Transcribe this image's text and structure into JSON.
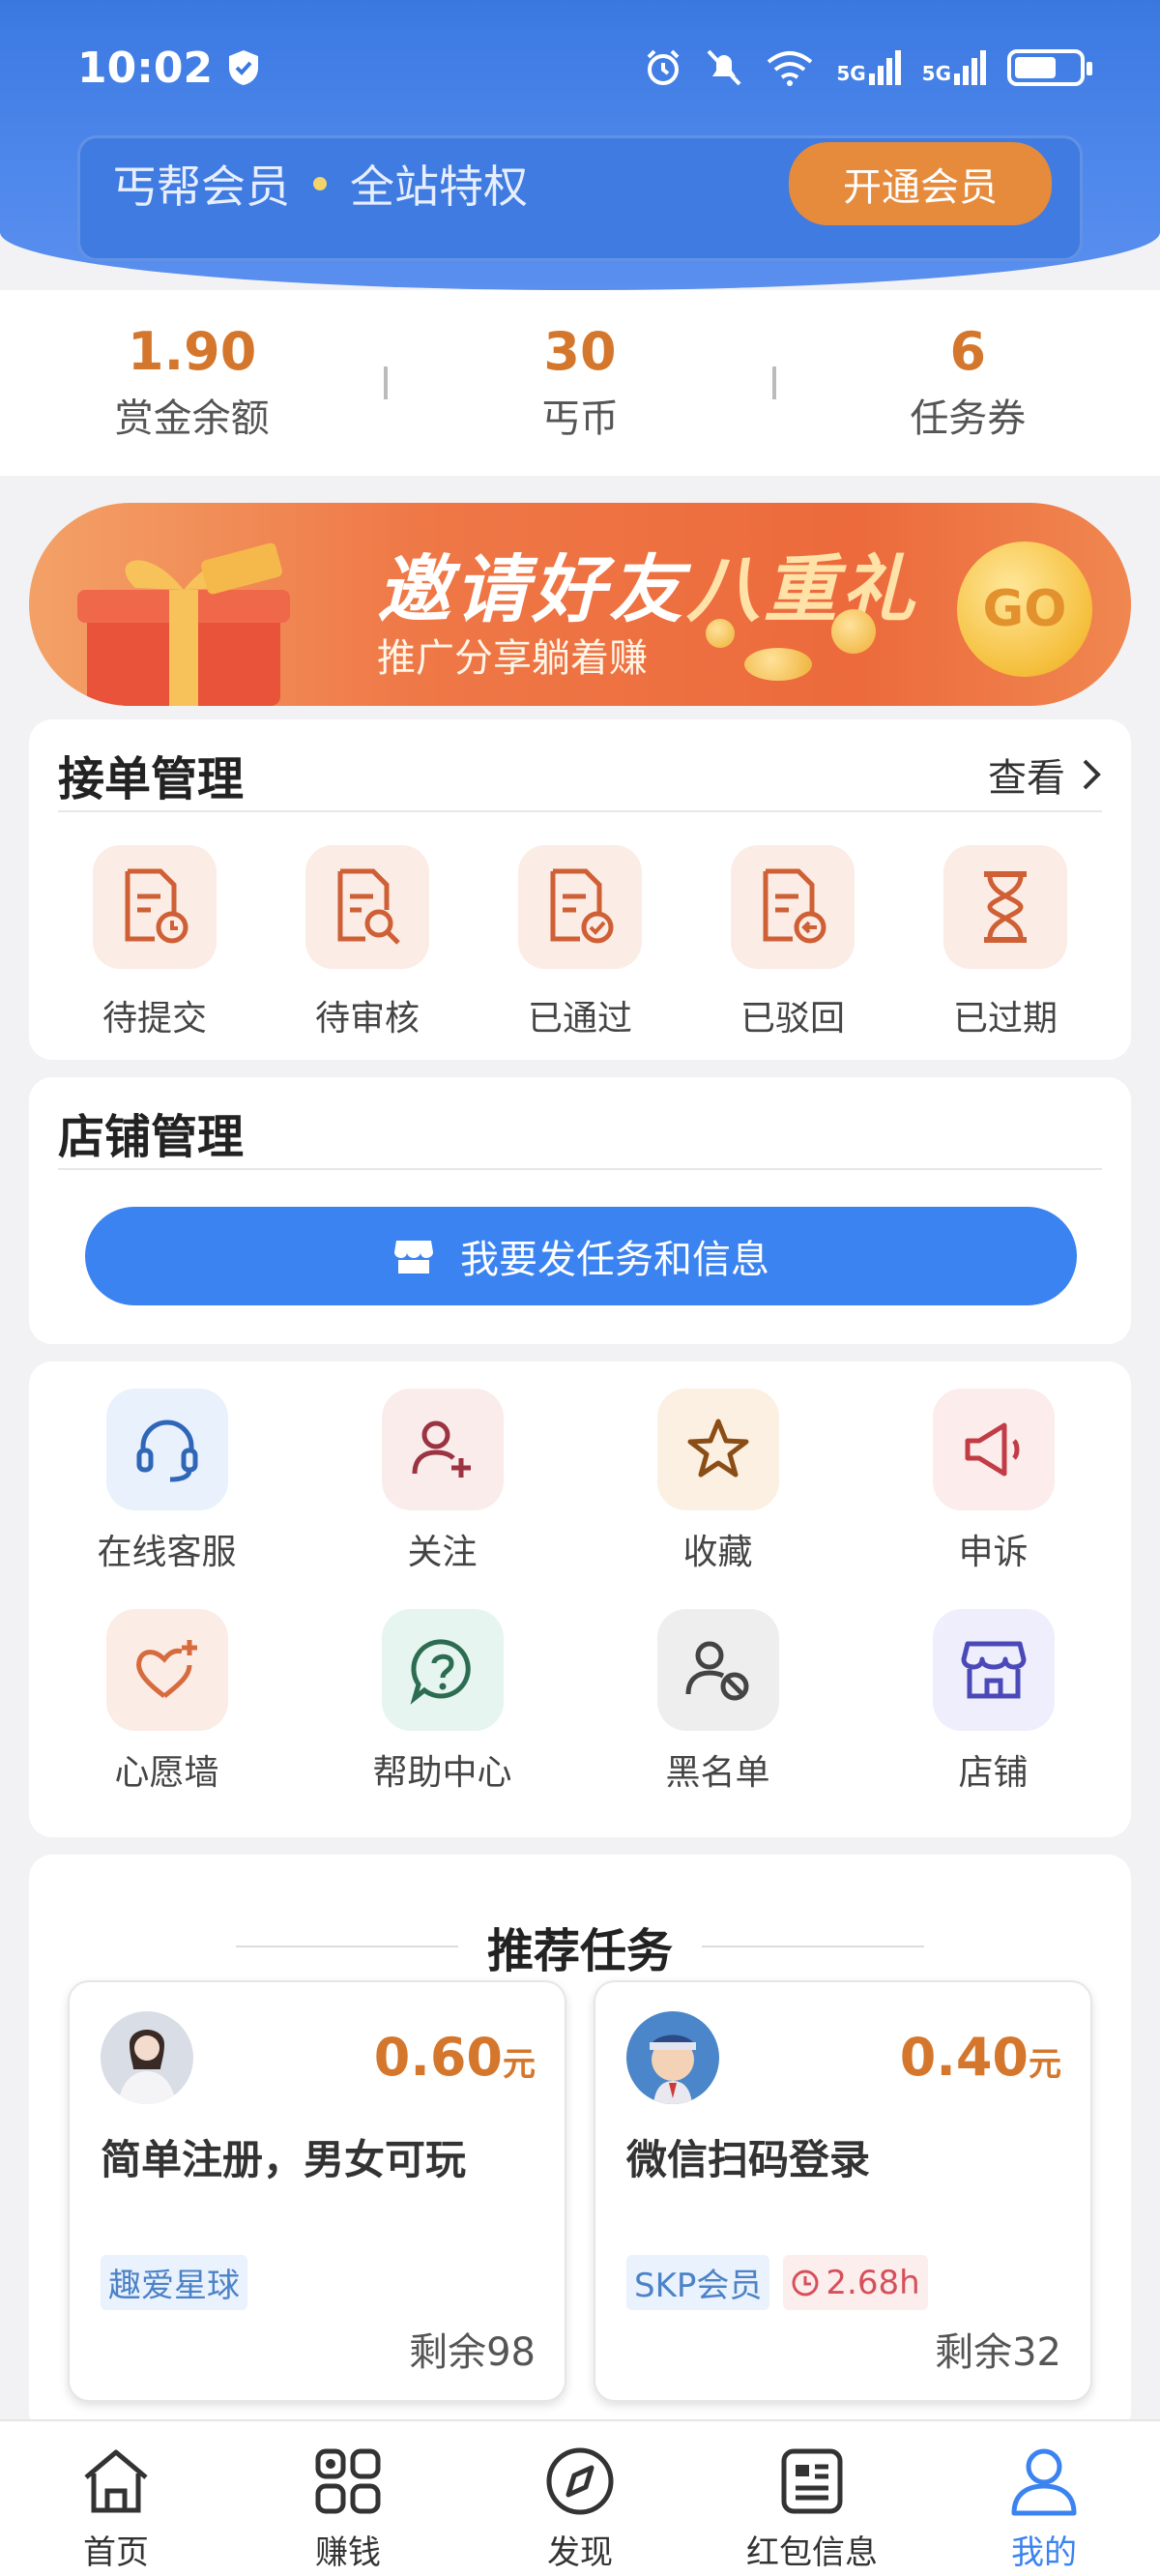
{
  "status_bar": {
    "time": "10:02",
    "signal_label_1": "5G",
    "signal_label_2": "5G"
  },
  "member": {
    "brand": "丐帮会员",
    "privilege": "全站特权",
    "open_button": "开通会员"
  },
  "stats": [
    {
      "value": "1.90",
      "label": "赏金余额"
    },
    {
      "value": "30",
      "label": "丐币"
    },
    {
      "value": "6",
      "label": "任务券"
    }
  ],
  "banner": {
    "title_a": "邀请好友",
    "title_b": "八重礼",
    "subtitle": "推广分享躺着赚",
    "go": "GO"
  },
  "orders": {
    "title": "接单管理",
    "view_more": "查看",
    "items": [
      {
        "label": "待提交",
        "icon": "doc-clock-icon"
      },
      {
        "label": "待审核",
        "icon": "doc-search-icon"
      },
      {
        "label": "已通过",
        "icon": "doc-check-icon"
      },
      {
        "label": "已驳回",
        "icon": "doc-return-icon"
      },
      {
        "label": "已过期",
        "icon": "hourglass-icon"
      }
    ]
  },
  "shop": {
    "title": "店铺管理",
    "publish_button": "我要发任务和信息"
  },
  "tools": [
    {
      "label": "在线客服",
      "icon": "headset-icon",
      "bg": "#e8f1fc",
      "color": "#2f66b8"
    },
    {
      "label": "关注",
      "icon": "user-plus-icon",
      "bg": "#fbecec",
      "color": "#9b3341"
    },
    {
      "label": "收藏",
      "icon": "star-icon",
      "bg": "#fbf0e1",
      "color": "#8b4d16"
    },
    {
      "label": "申诉",
      "icon": "megaphone-icon",
      "bg": "#fcecec",
      "color": "#c23c46"
    },
    {
      "label": "心愿墙",
      "icon": "heart-plus-icon",
      "bg": "#fcece6",
      "color": "#d66b3d"
    },
    {
      "label": "帮助中心",
      "icon": "help-icon",
      "bg": "#e6f5ef",
      "color": "#2c6d52"
    },
    {
      "label": "黑名单",
      "icon": "user-block-icon",
      "bg": "#eeeeee",
      "color": "#444444"
    },
    {
      "label": "店铺",
      "icon": "store-icon",
      "bg": "#eeeefc",
      "color": "#4b49b8"
    }
  ],
  "recommend": {
    "title": "推荐任务",
    "tasks": [
      {
        "price": "0.60",
        "unit": "元",
        "name": "简单注册，男女可玩",
        "tags": [
          "趣爱星球"
        ],
        "timer": "",
        "remaining": "剩余98"
      },
      {
        "price": "0.40",
        "unit": "元",
        "name": "微信扫码登录",
        "tags": [
          "SKP会员"
        ],
        "timer": "2.68h",
        "remaining": "剩余32"
      }
    ]
  },
  "nav": [
    {
      "label": "首页",
      "icon": "home-icon"
    },
    {
      "label": "赚钱",
      "icon": "grid-icon"
    },
    {
      "label": "发现",
      "icon": "compass-icon"
    },
    {
      "label": "红包信息",
      "icon": "news-icon"
    },
    {
      "label": "我的",
      "icon": "user-icon",
      "active": true
    }
  ],
  "colors": {
    "accent": "#3b83f0",
    "price": "#d4772d",
    "header": "#3a78e0"
  }
}
